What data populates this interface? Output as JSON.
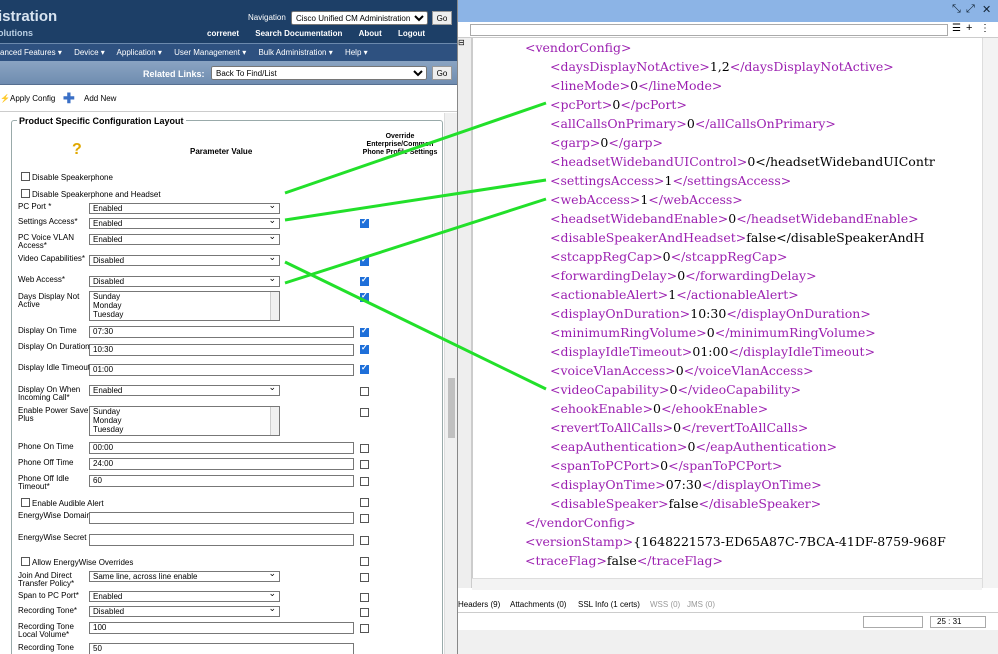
{
  "left": {
    "banner": {
      "title": "istration",
      "subtitle": "olutions",
      "nav_label": "Navigation",
      "nav_select": "Cisco Unified CM Administration",
      "go": "Go",
      "links": [
        "correnet",
        "Search Documentation",
        "About",
        "Logout"
      ]
    },
    "menu": [
      "anced Features ▾",
      "Device ▾",
      "Application ▾",
      "User Management ▾",
      "Bulk Administration ▾",
      "Help ▾"
    ],
    "related": {
      "label": "Related Links:",
      "select": "Back To Find/List",
      "go": "Go"
    },
    "toolbar": {
      "apply": "Apply Config",
      "add": "Add New"
    },
    "section": {
      "legend": "Product Specific Configuration Layout",
      "param_header": "Parameter Value",
      "override_header": "Override Enterprise/Common Phone Profile Settings",
      "help_icon": "?"
    },
    "checks": {
      "disable_speakerphone": "Disable Speakerphone",
      "disable_speaker_headset": "Disable Speakerphone and Headset",
      "enable_audible_alert": "Enable Audible Alert",
      "allow_energywise": "Allow EnergyWise Overrides"
    },
    "fields": {
      "pc_port": {
        "label": "PC Port *",
        "value": "Enabled"
      },
      "settings_access": {
        "label": "Settings Access*",
        "value": "Enabled"
      },
      "pc_voice_vlan": {
        "label": "PC Voice VLAN Access*",
        "value": "Enabled"
      },
      "video_cap": {
        "label": "Video Capabilities*",
        "value": "Disabled"
      },
      "web_access": {
        "label": "Web Access*",
        "value": "Disabled"
      },
      "days_not_active": {
        "label": "Days Display Not Active",
        "items": [
          "Sunday",
          "Monday",
          "Tuesday"
        ]
      },
      "display_on_time": {
        "label": "Display On Time",
        "value": "07:30"
      },
      "display_on_duration": {
        "label": "Display On Duration",
        "value": "10:30"
      },
      "display_idle_timeout": {
        "label": "Display Idle Timeout",
        "value": "01:00"
      },
      "display_on_incoming": {
        "label": "Display On When Incoming Call*",
        "value": "Enabled"
      },
      "power_save_plus": {
        "label": "Enable Power Save Plus",
        "items": [
          "Sunday",
          "Monday",
          "Tuesday"
        ]
      },
      "phone_on_time": {
        "label": "Phone On Time",
        "value": "00:00"
      },
      "phone_off_time": {
        "label": "Phone Off Time",
        "value": "24:00"
      },
      "phone_off_idle": {
        "label": "Phone Off Idle Timeout*",
        "value": "60"
      },
      "energywise_domain": {
        "label": "EnergyWise Domain",
        "value": ""
      },
      "energywise_secret": {
        "label": "EnergyWise Secret",
        "value": ""
      },
      "join_transfer": {
        "label": "Join And Direct Transfer Policy*",
        "value": "Same line, across line enable"
      },
      "span_pc_port": {
        "label": "Span to PC Port*",
        "value": "Enabled"
      },
      "recording_tone": {
        "label": "Recording Tone*",
        "value": "Disabled"
      },
      "recording_tone_local": {
        "label": "Recording Tone Local Volume*",
        "value": "100"
      },
      "recording_tone_cut": {
        "label": "Recording Tone",
        "value": "50"
      }
    }
  },
  "right": {
    "lines": [
      {
        "indent": 0,
        "text": "<vendorConfig>"
      },
      {
        "indent": 1,
        "text": "<daysDisplayNotActive>1,2</daysDisplayNotActive>"
      },
      {
        "indent": 1,
        "text": "<lineMode>0</lineMode>"
      },
      {
        "indent": 1,
        "text": "<pcPort>0</pcPort>"
      },
      {
        "indent": 1,
        "text": "<allCallsOnPrimary>0</allCallsOnPrimary>"
      },
      {
        "indent": 1,
        "text": "<garp>0</garp>"
      },
      {
        "indent": 1,
        "text": "<headsetWidebandUIControl>0</headsetWidebandUIContr"
      },
      {
        "indent": 1,
        "text": "<settingsAccess>1</settingsAccess>"
      },
      {
        "indent": 1,
        "text": "<webAccess>1</webAccess>"
      },
      {
        "indent": 1,
        "text": "<headsetWidebandEnable>0</headsetWidebandEnable>"
      },
      {
        "indent": 1,
        "text": "<disableSpeakerAndHeadset>false</disableSpeakerAndH"
      },
      {
        "indent": 1,
        "text": "<stcappRegCap>0</stcappRegCap>"
      },
      {
        "indent": 1,
        "text": "<forwardingDelay>0</forwardingDelay>"
      },
      {
        "indent": 1,
        "text": "<actionableAlert>1</actionableAlert>"
      },
      {
        "indent": 1,
        "text": "<displayOnDuration>10:30</displayOnDuration>"
      },
      {
        "indent": 1,
        "text": "<minimumRingVolume>0</minimumRingVolume>"
      },
      {
        "indent": 1,
        "text": "<displayIdleTimeout>01:00</displayIdleTimeout>"
      },
      {
        "indent": 1,
        "text": "<voiceVlanAccess>0</voiceVlanAccess>"
      },
      {
        "indent": 1,
        "text": "<videoCapability>0</videoCapability>"
      },
      {
        "indent": 1,
        "text": "<ehookEnable>0</ehookEnable>"
      },
      {
        "indent": 1,
        "text": "<revertToAllCalls>0</revertToAllCalls>"
      },
      {
        "indent": 1,
        "text": "<eapAuthentication>0</eapAuthentication>"
      },
      {
        "indent": 1,
        "text": "<spanToPCPort>0</spanToPCPort>"
      },
      {
        "indent": 1,
        "text": "<displayOnTime>07:30</displayOnTime>"
      },
      {
        "indent": 1,
        "text": "<disableSpeaker>false</disableSpeaker>"
      },
      {
        "indent": 0,
        "text": "</vendorConfig>"
      },
      {
        "indent": 0,
        "text": "<versionStamp>{1648221573-ED65A87C-7BCA-41DF-8759-968F"
      },
      {
        "indent": 0,
        "text": "<traceFlag>false</traceFlag>"
      }
    ],
    "tabs": [
      "Headers (9)",
      "Attachments (0)",
      "SSL Info (1 certs)",
      "WSS (0)",
      "JMS (0)"
    ],
    "cursor": "25 : 31",
    "colors": {
      "tag": "#9b1fb0",
      "title_bar": "#8cb4e6",
      "connector": "#22e02a"
    }
  }
}
